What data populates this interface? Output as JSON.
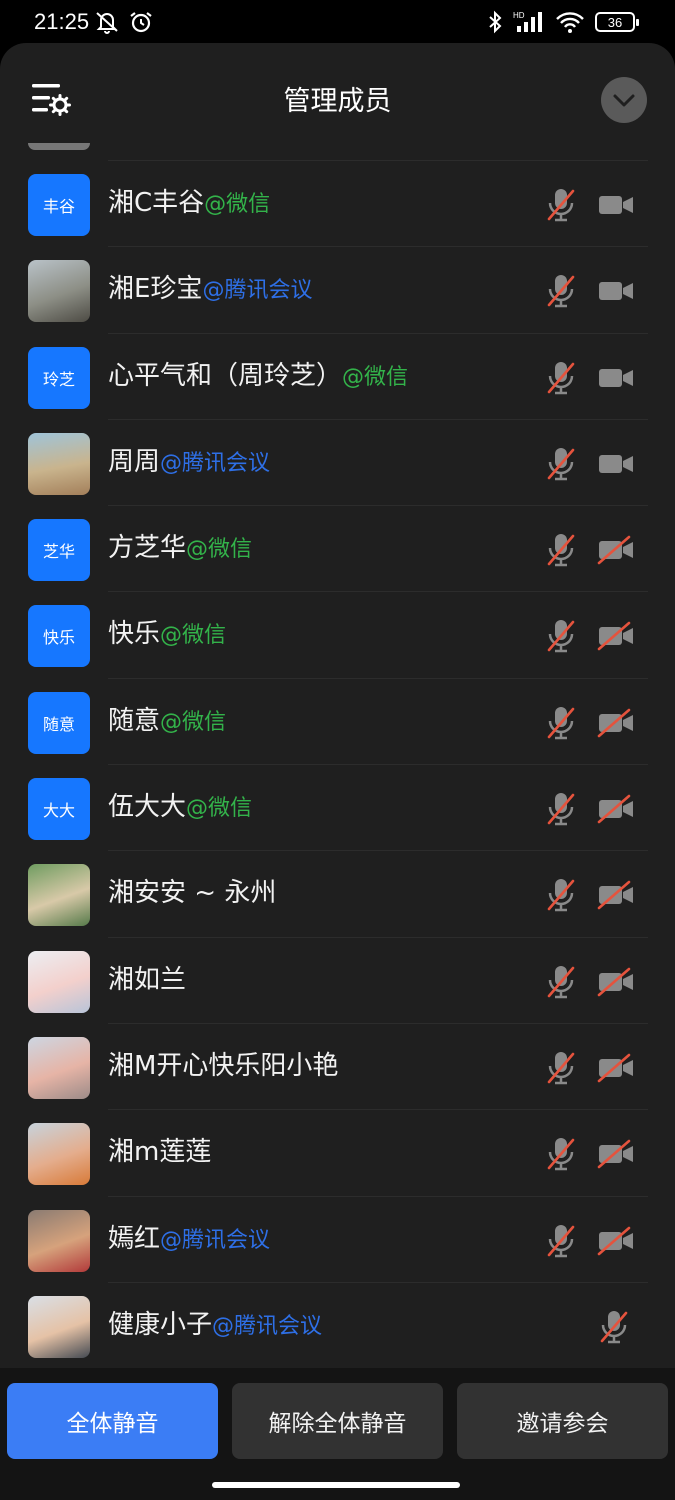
{
  "status_bar": {
    "time": "21:25",
    "battery": "36",
    "icons": [
      "dnd-icon",
      "alarm-icon",
      "bluetooth-icon",
      "signal-icon",
      "wifi-icon",
      "battery-icon"
    ]
  },
  "header": {
    "title": "管理成员",
    "settings_icon": "list-settings-icon",
    "collapse_icon": "chevron-down-icon"
  },
  "colors": {
    "primary": "#3b7df5",
    "avatar_blue": "#1677ff",
    "wechat_green": "#33b34a",
    "tencent_blue": "#2e6fe6",
    "muted_red": "#e5533d",
    "background": "#1f1f1f"
  },
  "members": [
    {
      "avatar": "丰谷",
      "name": "湘C丰谷",
      "source": "@微信"
    },
    {
      "avatar": "",
      "name": "湘E珍宝",
      "source": "@腾讯会议"
    },
    {
      "avatar": "玲芝",
      "name": "心平气和（周玲芝）",
      "source": "@微信"
    },
    {
      "avatar": "",
      "name": "周周",
      "source": "@腾讯会议"
    },
    {
      "avatar": "芝华",
      "name": "方芝华",
      "source": "@微信"
    },
    {
      "avatar": "快乐",
      "name": "快乐",
      "source": "@微信"
    },
    {
      "avatar": "随意",
      "name": "随意",
      "source": "@微信"
    },
    {
      "avatar": "大大",
      "name": "伍大大",
      "source": "@微信"
    },
    {
      "avatar": "",
      "name": "湘安安 ~ 永州",
      "source": ""
    },
    {
      "avatar": "",
      "name": "湘如兰",
      "source": ""
    },
    {
      "avatar": "",
      "name": "湘M开心快乐阳小艳",
      "source": ""
    },
    {
      "avatar": "",
      "name": "湘m莲莲",
      "source": ""
    },
    {
      "avatar": "",
      "name": "嫣红",
      "source": "@腾讯会议"
    },
    {
      "avatar": "",
      "name": "健康小子",
      "source": "@腾讯会议"
    }
  ],
  "footer": {
    "mute_all": "全体静音",
    "unmute_all": "解除全体静音",
    "invite": "邀请参会"
  }
}
